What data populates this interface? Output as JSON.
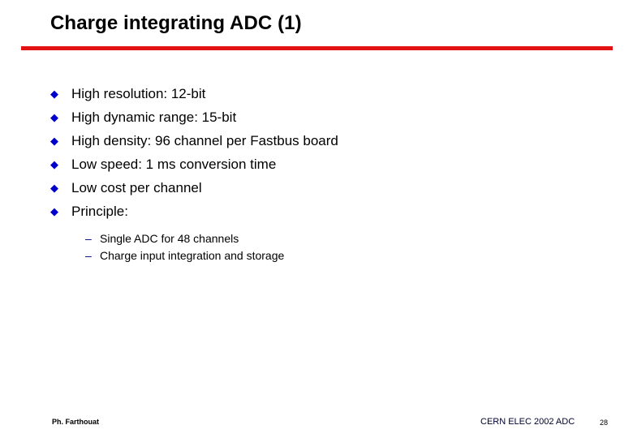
{
  "slide": {
    "title": "Charge integrating ADC (1)",
    "rule_color": "#e21212",
    "background_color": "#ffffff"
  },
  "bullets": {
    "marker_glyph": "◆",
    "marker_color": "#0000cc",
    "items": [
      {
        "text": "High resolution: 12-bit"
      },
      {
        "text": "High dynamic range: 15-bit"
      },
      {
        "text": "High density: 96 channel per Fastbus board"
      },
      {
        "text": "Low speed: 1 ms conversion time"
      },
      {
        "text": "Low cost per channel"
      },
      {
        "text": "Principle:"
      }
    ]
  },
  "sub_bullets": {
    "marker_glyph": "–",
    "marker_color": "#000080",
    "items": [
      {
        "text": "Single ADC for 48 channels"
      },
      {
        "text": "Charge input integration and storage"
      }
    ]
  },
  "footer": {
    "author": "Ph. Farthouat",
    "event": "CERN ELEC 2002 ADC",
    "page_number": "28"
  }
}
